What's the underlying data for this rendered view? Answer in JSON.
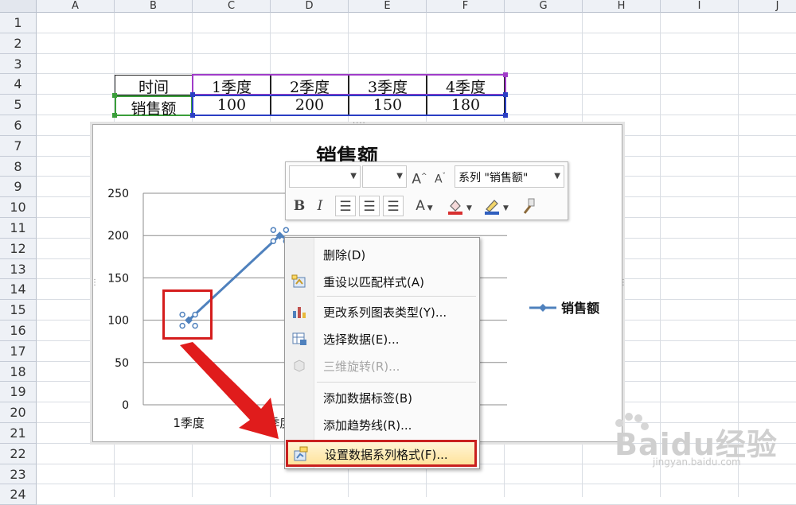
{
  "columns": [
    "A",
    "B",
    "C",
    "D",
    "E",
    "F",
    "G",
    "H",
    "I",
    "J"
  ],
  "rows": [
    "1",
    "2",
    "3",
    "4",
    "5",
    "6",
    "7",
    "8",
    "9",
    "10",
    "11",
    "12",
    "13",
    "14",
    "15",
    "16",
    "17",
    "18",
    "19",
    "20",
    "21",
    "22",
    "23",
    "24"
  ],
  "table": {
    "header_label": "时间",
    "value_label": "销售额",
    "categories": [
      "1季度",
      "2季度",
      "3季度",
      "4季度"
    ],
    "values": [
      "100",
      "200",
      "150",
      "180"
    ]
  },
  "chart_data": {
    "type": "line",
    "title": "销售额",
    "categories": [
      "1季度",
      "2季度",
      "3季度",
      "4季度"
    ],
    "x_tick_labels_visible": [
      "1季度",
      "季度"
    ],
    "series": [
      {
        "name": "销售额",
        "values": [
          100,
          200,
          150,
          180
        ],
        "color": "#4f81bd"
      }
    ],
    "ylim": [
      0,
      250
    ],
    "yticks": [
      "0",
      "50",
      "100",
      "150",
      "200",
      "250"
    ],
    "grid": true,
    "legend": "right"
  },
  "mini_toolbar": {
    "series_select": "系列 \"销售额\"",
    "grow_font": "A",
    "shrink_font": "A",
    "bold": "B",
    "italic": "I",
    "font_color": "A"
  },
  "context_menu": {
    "items": [
      {
        "label": "删除(D)",
        "icon": "delete-icon",
        "enabled": true
      },
      {
        "label": "重设以匹配样式(A)",
        "icon": "reset-style-icon",
        "enabled": true
      },
      {
        "label": "更改系列图表类型(Y)...",
        "icon": "chart-type-icon",
        "enabled": true
      },
      {
        "label": "选择数据(E)...",
        "icon": "select-data-icon",
        "enabled": true
      },
      {
        "label": "三维旋转(R)...",
        "icon": "rotate-3d-icon",
        "enabled": false
      },
      {
        "label": "添加数据标签(B)",
        "icon": "",
        "enabled": true
      },
      {
        "label": "添加趋势线(R)...",
        "icon": "",
        "enabled": true
      },
      {
        "label": "设置数据系列格式(F)...",
        "icon": "format-series-icon",
        "enabled": true
      }
    ]
  },
  "colors": {
    "series": "#4f81bd",
    "annotation": "#d51d1d",
    "highlight_border": "#c9201f"
  },
  "watermark": {
    "brand": "Baidu经验",
    "sub": "jingyan.baidu.com"
  }
}
